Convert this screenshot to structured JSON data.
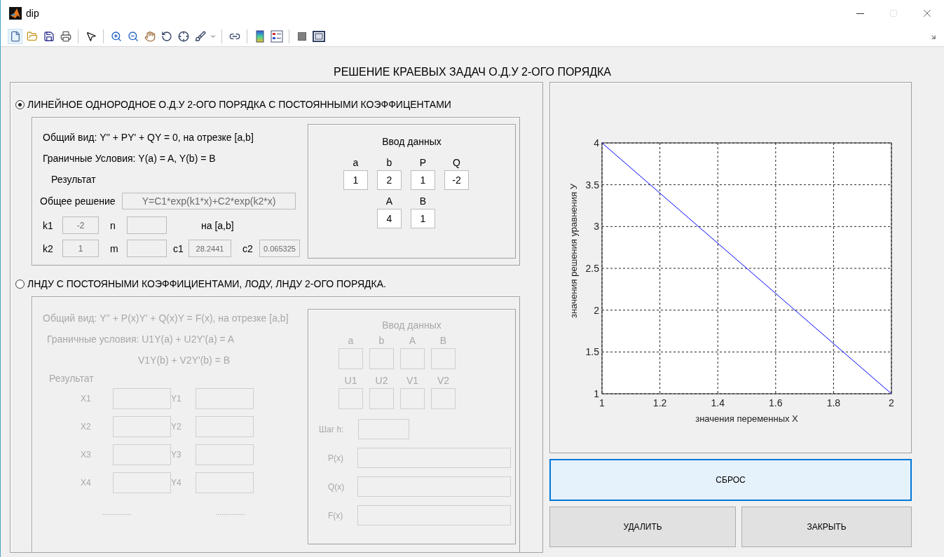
{
  "window": {
    "title": "dip"
  },
  "heading": "РЕШЕНИЕ КРАЕВЫХ ЗАДАЧ О.Д.У 2-ОГО ПОРЯДКА",
  "modes": [
    {
      "label": "ЛИНЕЙНОЕ ОДНОРОДНОЕ О.Д.У 2-ОГО ПОРЯДКА С ПОСТОЯННЫМИ КОЭФФИЦЕНТАМИ",
      "selected": true
    },
    {
      "label": "ЛНДУ С ПОСТОЯНЫМИ КОЭФФИЦИЕНТАМИ, ЛОДУ, ЛНДУ 2-ОГО ПОРЯДКА.",
      "selected": false
    }
  ],
  "homogeneous": {
    "disabled": false,
    "general_form": "Общий вид: Y'' + PY' + QY = 0, на отрезке [a,b]",
    "boundary_conditions": "Граничные Условия: Y(a) = A, Y(b) = B",
    "result_label": "Результат",
    "general_solution": {
      "label": "Общее решение",
      "value": "Y=C1*exp(k1*x)+C2*exp(k2*x)"
    },
    "result_fields": [
      {
        "label": "k1",
        "value": "-2"
      },
      {
        "label": "n"
      },
      {
        "label": "k2",
        "value": "1"
      },
      {
        "label": "m"
      },
      {
        "label": "c1",
        "value": "28.2441"
      },
      {
        "label": "c2",
        "value": "0.065325"
      }
    ],
    "interval_label": "на [a,b]",
    "input": {
      "title": "Ввод данных",
      "fields": [
        {
          "label": "a",
          "value": "1"
        },
        {
          "label": "b",
          "value": "2"
        },
        {
          "label": "P",
          "value": "1"
        },
        {
          "label": "Q",
          "value": "-2"
        },
        {
          "label": "A",
          "value": "4"
        },
        {
          "label": "B",
          "value": "1"
        }
      ]
    }
  },
  "nonhomogeneous": {
    "disabled": true,
    "general_form": "Общий вид: Y'' + P(x)Y' + Q(x)Y = F(x), на отрезке [a,b]",
    "boundary_conditions": [
      "Граничные условия: U1Y(a) + U2Y'(a) = A",
      "V1Y(b) + V2Y'(b) = B"
    ],
    "result_label": "Результат",
    "result_fields": [
      {
        "label": "X1"
      },
      {
        "label": "Y1"
      },
      {
        "label": "X2"
      },
      {
        "label": "Y2"
      },
      {
        "label": "X3"
      },
      {
        "label": "Y3"
      },
      {
        "label": "X4"
      },
      {
        "label": "Y4"
      }
    ],
    "ellipses": [
      "...............",
      "..............."
    ],
    "input": {
      "title": "Ввод данных",
      "fields": [
        {
          "label": "a"
        },
        {
          "label": "b"
        },
        {
          "label": "A"
        },
        {
          "label": "B"
        },
        {
          "label": "U1"
        },
        {
          "label": "U2"
        },
        {
          "label": "V1"
        },
        {
          "label": "V2"
        }
      ],
      "functions": [
        {
          "label": "Шаг h:"
        },
        {
          "label": "P(x)"
        },
        {
          "label": "Q(x)"
        },
        {
          "label": "F(x)"
        }
      ]
    }
  },
  "plot": {
    "chart_data": {
      "type": "line",
      "xlabel": "значения переменных X",
      "ylabel": "значения решения уравнения У",
      "x": [
        1,
        2
      ],
      "series": [
        {
          "color": "#0000ff",
          "values": [
            4,
            1
          ]
        }
      ],
      "grid": true,
      "xlim": [
        1,
        2
      ],
      "ylim": [
        1,
        4
      ],
      "xticks": [
        1,
        1.2,
        1.4,
        1.6,
        1.8,
        2
      ],
      "yticks": [
        1,
        1.5,
        2,
        2.5,
        3,
        3.5,
        4
      ]
    }
  },
  "buttons": [
    {
      "label": "СБРОС",
      "focused": true
    },
    {
      "label": "УДАЛИТЬ",
      "focused": false
    },
    {
      "label": "ЗАКРЫТЬ",
      "focused": false
    }
  ]
}
